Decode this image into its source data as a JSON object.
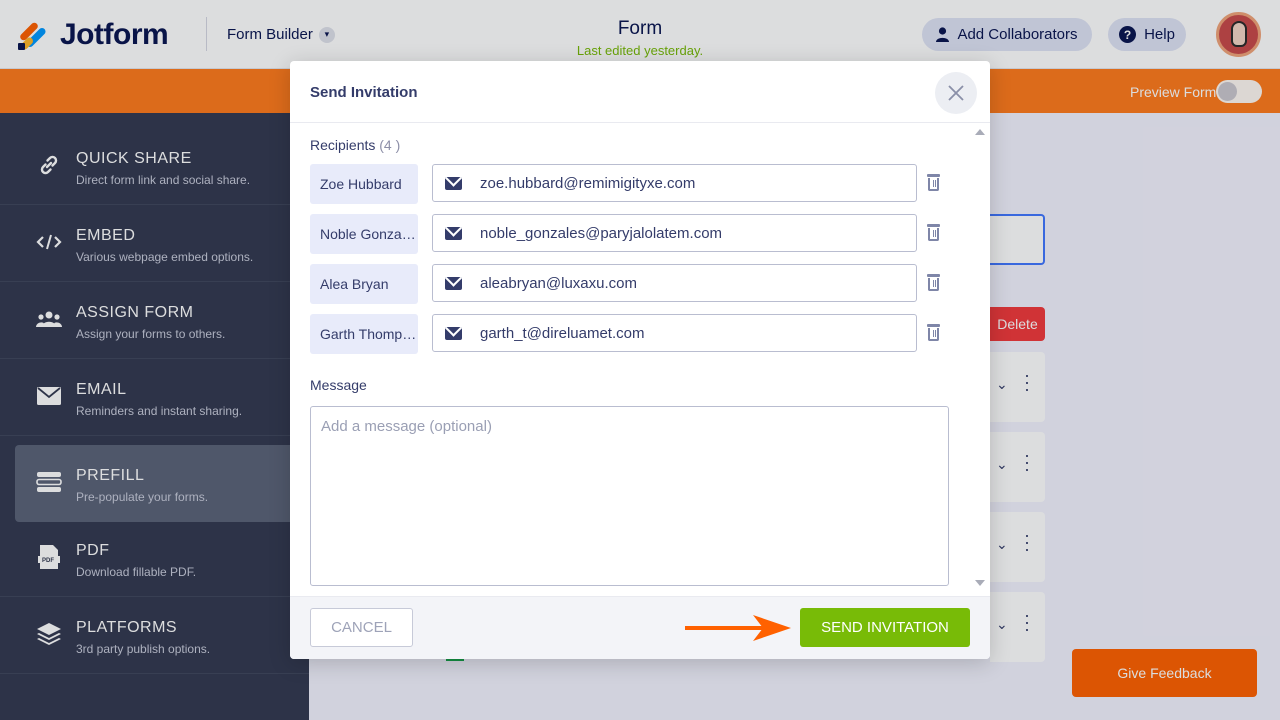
{
  "header": {
    "logo_text": "Jotform",
    "builder_label": "Form Builder",
    "form_title": "Form",
    "form_subtitle": "Last edited yesterday.",
    "collaborators_label": "Add Collaborators",
    "help_label": "Help"
  },
  "publish_bar": {
    "preview_label": "Preview Form"
  },
  "sidebar": {
    "items": [
      {
        "title": "QUICK SHARE",
        "desc": "Direct form link and social share.",
        "icon": "link-icon"
      },
      {
        "title": "EMBED",
        "desc": "Various webpage embed options.",
        "icon": "code-icon"
      },
      {
        "title": "ASSIGN FORM",
        "desc": "Assign your forms to others.",
        "icon": "users-icon"
      },
      {
        "title": "EMAIL",
        "desc": "Reminders and instant sharing.",
        "icon": "envelope-icon"
      },
      {
        "title": "PREFILL",
        "desc": "Pre-populate your forms.",
        "icon": "prefill-icon",
        "active": true
      },
      {
        "title": "PDF",
        "desc": "Download fillable PDF.",
        "icon": "pdf-icon"
      },
      {
        "title": "PLATFORMS",
        "desc": "3rd party publish options.",
        "icon": "layers-icon"
      }
    ]
  },
  "background": {
    "delete_label": "Delete",
    "feedback_label": "Give Feedback"
  },
  "modal": {
    "title": "Send Invitation",
    "recipients_label": "Recipients",
    "recipients_count": "(4 )",
    "recipients": [
      {
        "name": "Zoe Hubbard",
        "email": "zoe.hubbard@remimigityxe.com"
      },
      {
        "name": "Noble Gonzales",
        "email": "noble_gonzales@paryjalolatem.com"
      },
      {
        "name": "Alea Bryan",
        "email": "aleabryan@luxaxu.com"
      },
      {
        "name": "Garth Thompson",
        "email": "garth_t@direluamet.com"
      }
    ],
    "message_label": "Message",
    "message_placeholder": "Add a message (optional)",
    "message_value": "",
    "cancel_label": "CANCEL",
    "send_label": "SEND INVITATION"
  },
  "colors": {
    "accent_orange": "#ff7b1c",
    "send_green": "#78bb07",
    "sidebar_bg": "#343a51",
    "delete_red": "#f23a3c",
    "arrow_orange": "#ff6100"
  }
}
